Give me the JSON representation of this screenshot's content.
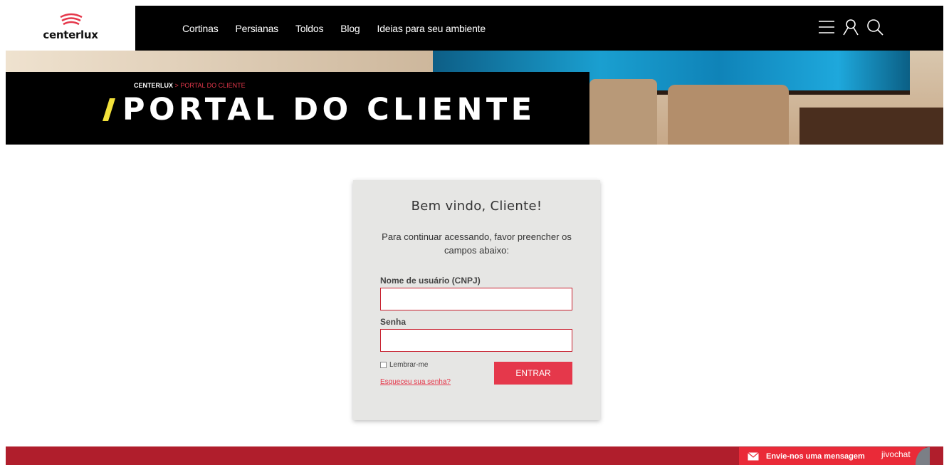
{
  "brand": {
    "name": "centerlux"
  },
  "nav": {
    "items": [
      {
        "label": "Cortinas"
      },
      {
        "label": "Persianas"
      },
      {
        "label": "Toldos"
      },
      {
        "label": "Blog"
      },
      {
        "label": "Ideias para seu ambiente"
      }
    ]
  },
  "header_icons": [
    "menu-icon",
    "user-icon",
    "search-icon"
  ],
  "breadcrumb": {
    "home": "CENTERLUX",
    "separator": ">",
    "current": "PORTAL DO CLIENTE"
  },
  "page_title": "PORTAL DO CLIENTE",
  "login": {
    "title": "Bem vindo, Cliente!",
    "subtitle": "Para continuar acessando, favor preencher os campos abaixo:",
    "username_label": "Nome de usuário (CNPJ)",
    "username_value": "",
    "password_label": "Senha",
    "password_value": "",
    "remember_label": "Lembrar-me",
    "remember_checked": false,
    "forgot_label": "Esqueceu sua senha?",
    "submit_label": "ENTRAR"
  },
  "chat_widget": {
    "message": "Envie-nos uma mensagem",
    "brand": "jivochat"
  },
  "colors": {
    "accent": "#e5384b",
    "footer": "#b01e2c",
    "header": "#000000",
    "slash": "#f2e13a"
  }
}
